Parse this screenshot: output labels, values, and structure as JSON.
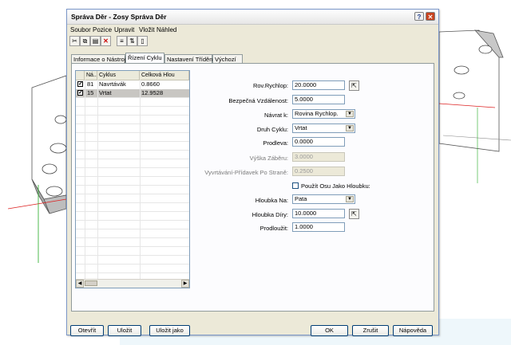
{
  "window": {
    "title": "Správa Děr - Zosy Správa Děr",
    "help_glyph": "?",
    "close_glyph": "✕"
  },
  "menu": [
    "Soubor",
    "Pozice",
    "Upravit",
    "Vložit",
    "Náhled"
  ],
  "toolbar_icons": [
    "scissors-icon",
    "copy-icon",
    "paste-icon",
    "delete-x-icon",
    "align-icon",
    "sort-icon",
    "preview-icon"
  ],
  "tabs": [
    "Informace o Nástroji",
    "Řízení Cyklu",
    "Nastavení Třídění",
    "Výchozí"
  ],
  "active_tab": 1,
  "list": {
    "columns": [
      "Ná...",
      "Cyklus",
      "Celková Hlou"
    ],
    "rows": [
      {
        "checked": true,
        "num": "81",
        "cycle": "Navrtávák",
        "depth": "0.8660",
        "selected": false
      },
      {
        "checked": true,
        "num": "15",
        "cycle": "Vrtat",
        "depth": "12.9528",
        "selected": true
      }
    ]
  },
  "form": {
    "rov_rychlop_label": "Rov.Rychlop:",
    "rov_rychlop_value": "20.0000",
    "bezpecna_label": "Bezpečná Vzdálenost:",
    "bezpecna_value": "5.0000",
    "navrat_label": "Návrat k:",
    "navrat_value": "Rovina Rychlop.",
    "druh_label": "Druh Cyklu:",
    "druh_value": "Vrtat",
    "prodleva_label": "Prodleva:",
    "prodleva_value": "0.0000",
    "vyska_label": "Výška Záběru:",
    "vyska_value": "3.0000",
    "vyvrtavani_label": "Vyvrtávání-Přídavek Po Straně:",
    "vyvrtavani_value": "0.2500",
    "osa_label": "Použít Osu Jako Hloubku:",
    "osa_checked": false,
    "hloubka_na_label": "Hloubka Na:",
    "hloubka_na_value": "Pata",
    "hloubka_diry_label": "Hloubka Díry:",
    "hloubka_diry_value": "10.0000",
    "prodlouzit_label": "Prodloužit:",
    "prodlouzit_value": "1.0000"
  },
  "buttons": {
    "open": "Otevřít",
    "save": "Uložit",
    "save_as": "Uložit jako",
    "ok": "OK",
    "cancel": "Zrušit",
    "help": "Nápověda"
  }
}
